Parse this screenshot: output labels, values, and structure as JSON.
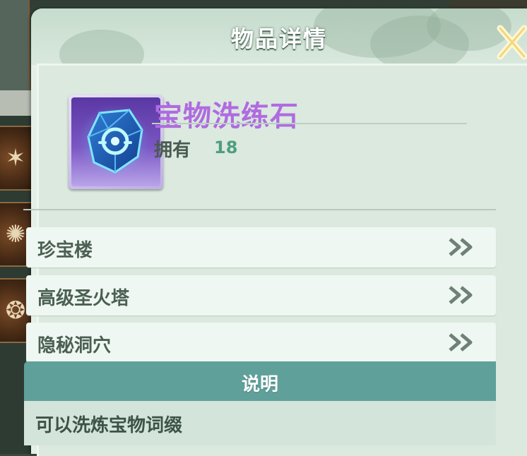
{
  "dialog": {
    "title": "物品详情"
  },
  "item": {
    "name": "宝物洗练石",
    "own_label": "拥有",
    "own_count": "18",
    "name_color": "#b06be0",
    "icon": "gem-icon"
  },
  "sources": [
    {
      "label": "珍宝楼"
    },
    {
      "label": "高级圣火塔"
    },
    {
      "label": "隐秘洞穴"
    }
  ],
  "description": {
    "title": "说明",
    "text": "可以洗炼宝物词缀"
  },
  "colors": {
    "accent_teal": "#5fa09a",
    "count_green": "#4f9e7f",
    "panel_bg": "#dbe9df"
  }
}
